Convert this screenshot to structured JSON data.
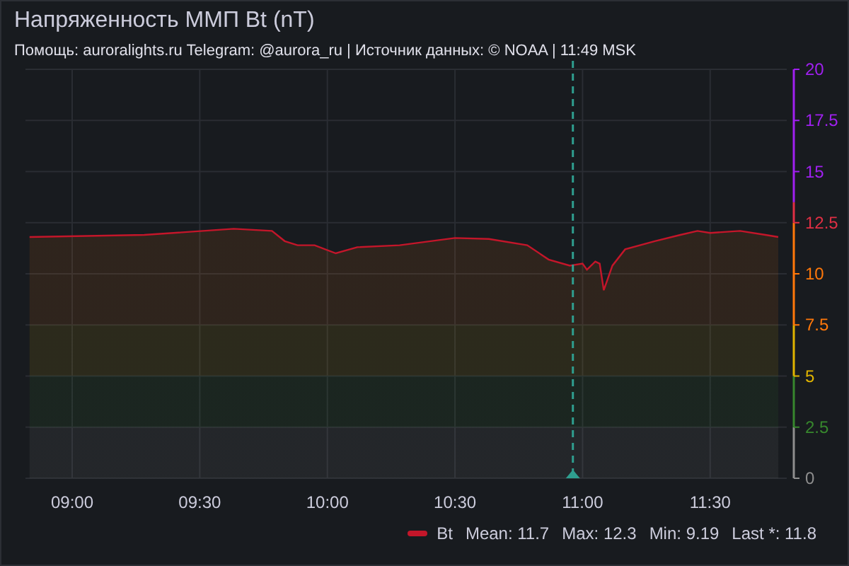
{
  "panel": {
    "title": "Напряженность ММП Bt (nT)",
    "subtitle": "Помощь: auroralights.ru Telegram: @aurora_ru | Источник данных:  © NOAA | 11:49 MSK",
    "chart_data": {
      "type": "area",
      "x": [
        8.833,
        9.283,
        9.633,
        9.783,
        9.833,
        9.883,
        9.95,
        10.033,
        10.117,
        10.283,
        10.5,
        10.633,
        10.783,
        10.867,
        10.95,
        11.0,
        11.017,
        11.05,
        11.067,
        11.083,
        11.117,
        11.167,
        11.283,
        11.383,
        11.45,
        11.5,
        11.617,
        11.717,
        11.767
      ],
      "series": [
        {
          "name": "Bt",
          "color": "#c4162a",
          "values": [
            11.8,
            11.9,
            12.2,
            12.1,
            11.6,
            11.4,
            11.4,
            11.0,
            11.3,
            11.4,
            11.75,
            11.7,
            11.4,
            10.7,
            10.4,
            10.5,
            10.2,
            10.6,
            10.5,
            9.2,
            10.4,
            11.2,
            11.6,
            11.9,
            12.1,
            12.0,
            12.1,
            11.9,
            11.8
          ]
        }
      ],
      "xlim": [
        8.817,
        11.8
      ],
      "ylim": [
        0,
        20
      ],
      "xticks": [
        {
          "value": 9,
          "label": "09:00"
        },
        {
          "value": 9.5,
          "label": "09:30"
        },
        {
          "value": 10,
          "label": "10:00"
        },
        {
          "value": 10.5,
          "label": "10:30"
        },
        {
          "value": 11,
          "label": "11:00"
        },
        {
          "value": 11.5,
          "label": "11:30"
        }
      ],
      "yticks": [
        {
          "value": 0,
          "label": "0"
        },
        {
          "value": 2.5,
          "label": "2.5"
        },
        {
          "value": 5,
          "label": "5"
        },
        {
          "value": 7.5,
          "label": "7.5"
        },
        {
          "value": 10,
          "label": "10"
        },
        {
          "value": 12.5,
          "label": "12.5"
        },
        {
          "value": 15,
          "label": "15"
        },
        {
          "value": 17.5,
          "label": "17.5"
        },
        {
          "value": 20,
          "label": "20"
        }
      ],
      "grid": true,
      "ref_lines": [
        {
          "axis": "x",
          "value": 10.962,
          "color": "#2f9e8f"
        }
      ]
    },
    "legend": {
      "stats": [
        "Mean: 11.7",
        "Max: 12.3",
        "Min: 9.19",
        "Last *: 11.8"
      ]
    }
  }
}
